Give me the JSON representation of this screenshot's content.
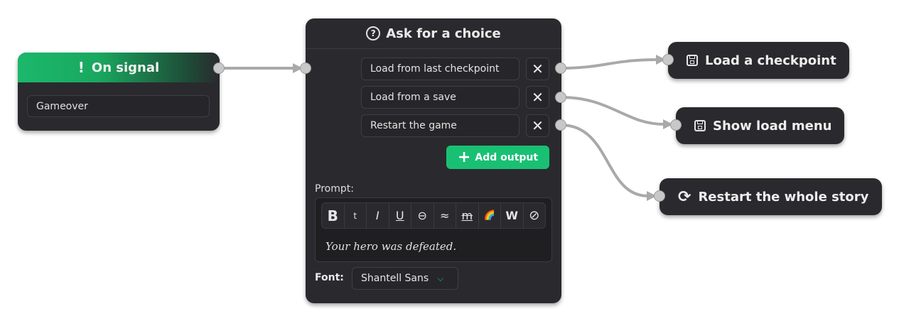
{
  "signal_node": {
    "title": "On signal",
    "icon": "exclamation-icon",
    "signal_value": "Gameover",
    "accent": "#1bb86b"
  },
  "choice_node": {
    "title": "Ask for a choice",
    "icon": "question-circle-icon",
    "options": [
      "Load from last checkpoint",
      "Load from a save",
      "Restart the game"
    ],
    "remove_symbol": "✕",
    "add_output_label": "Add output",
    "prompt_label": "Prompt:",
    "toolbar": [
      "B",
      "t",
      "I",
      "U",
      "⊖",
      "≈",
      "m",
      "🌈",
      "W",
      "⊘"
    ],
    "prompt_text": "Your hero was defeated.",
    "font_label": "Font:",
    "font_value": "Shantell Sans",
    "accent": "#19c074"
  },
  "targets": {
    "load_checkpoint": "Load a checkpoint",
    "show_load_menu": "Show load menu",
    "restart_story": "Restart the whole story"
  },
  "colors": {
    "node_bg": "#2a2a2e",
    "wire": "#a9a9a9"
  }
}
